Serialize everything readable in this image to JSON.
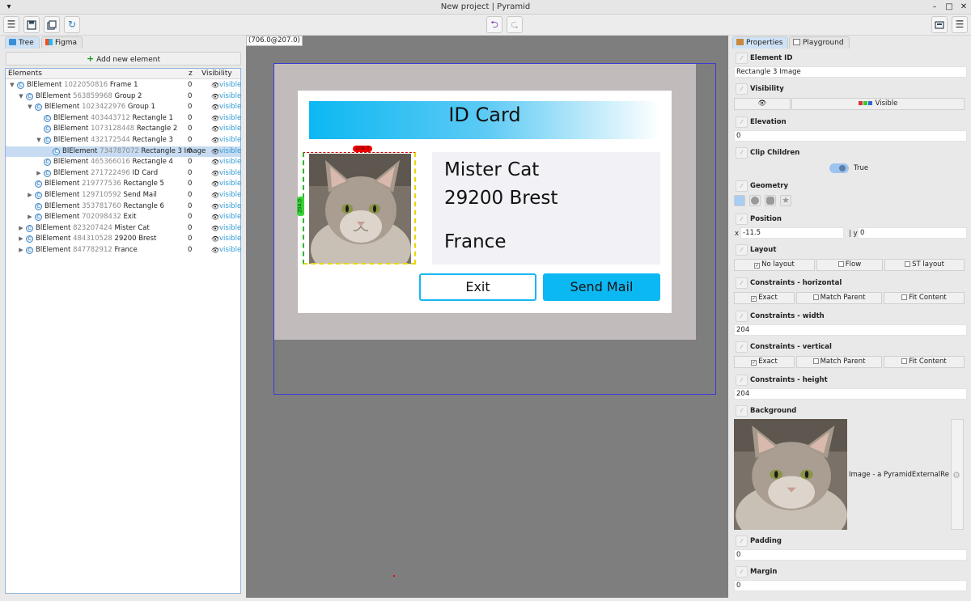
{
  "window": {
    "title": "New project | Pyramid"
  },
  "toolbar": {
    "undo_icon": "undo-arrow-icon",
    "redo_icon": "redo-arrow-icon"
  },
  "left_panel": {
    "tabs": [
      "Tree",
      "Figma"
    ],
    "add_button": "Add new element",
    "columns": {
      "elements": "Elements",
      "z": "z",
      "visibility": "Visibility"
    },
    "rows": [
      {
        "depth": 0,
        "expanded": "open",
        "type": "BlElement",
        "id": "1022050816",
        "name": "Frame 1",
        "z": "0",
        "visibility": "visible"
      },
      {
        "depth": 1,
        "expanded": "open",
        "type": "BlElement",
        "id": "563859968",
        "name": "Group 2",
        "z": "0",
        "visibility": "visible"
      },
      {
        "depth": 2,
        "expanded": "open",
        "type": "BlElement",
        "id": "1023422976",
        "name": "Group 1",
        "z": "0",
        "visibility": "visible"
      },
      {
        "depth": 3,
        "expanded": "none",
        "type": "BlElement",
        "id": "403443712",
        "name": "Rectangle 1",
        "z": "0",
        "visibility": "visible"
      },
      {
        "depth": 3,
        "expanded": "none",
        "type": "BlElement",
        "id": "1073128448",
        "name": "Rectangle 2",
        "z": "0",
        "visibility": "visible"
      },
      {
        "depth": 3,
        "expanded": "open",
        "type": "BlElement",
        "id": "432172544",
        "name": "Rectangle 3",
        "z": "0",
        "visibility": "visible"
      },
      {
        "depth": 4,
        "expanded": "none",
        "type": "BlElement",
        "id": "734787072",
        "name": "Rectangle 3 Image",
        "z": "0",
        "visibility": "visible",
        "selected": true
      },
      {
        "depth": 3,
        "expanded": "none",
        "type": "BlElement",
        "id": "465366016",
        "name": "Rectangle 4",
        "z": "0",
        "visibility": "visible"
      },
      {
        "depth": 3,
        "expanded": "closed",
        "type": "BlElement",
        "id": "271722496",
        "name": "ID Card",
        "z": "0",
        "visibility": "visible"
      },
      {
        "depth": 2,
        "expanded": "none",
        "type": "BlElement",
        "id": "219777536",
        "name": "Rectangle 5",
        "z": "0",
        "visibility": "visible"
      },
      {
        "depth": 2,
        "expanded": "closed",
        "type": "BlElement",
        "id": "129710592",
        "name": "Send Mail",
        "z": "0",
        "visibility": "visible"
      },
      {
        "depth": 2,
        "expanded": "none",
        "type": "BlElement",
        "id": "353781760",
        "name": "Rectangle 6",
        "z": "0",
        "visibility": "visible"
      },
      {
        "depth": 2,
        "expanded": "closed",
        "type": "BlElement",
        "id": "702098432",
        "name": "Exit",
        "z": "0",
        "visibility": "visible"
      },
      {
        "depth": 1,
        "expanded": "closed",
        "type": "BlElement",
        "id": "823207424",
        "name": "Mister Cat",
        "z": "0",
        "visibility": "visible"
      },
      {
        "depth": 1,
        "expanded": "closed",
        "type": "BlElement",
        "id": "484310528",
        "name": "29200 Brest",
        "z": "0",
        "visibility": "visible"
      },
      {
        "depth": 1,
        "expanded": "closed",
        "type": "BlElement",
        "id": "847782912",
        "name": "France",
        "z": "0",
        "visibility": "visible"
      }
    ]
  },
  "canvas": {
    "coordinate_readout": "(706.0@207.0)",
    "card": {
      "title": "ID Card",
      "name": "Mister Cat",
      "city": "29200 Brest",
      "country": "France",
      "exit_label": "Exit",
      "send_label": "Send Mail"
    },
    "selection": {
      "width_badge": "204.0",
      "height_badge": "204.0"
    },
    "colors": {
      "accent": "#0cb8f2",
      "frame_bg": "#c1bbbb",
      "canvas_bg": "#7e7e7e"
    }
  },
  "right_panel": {
    "tabs": [
      "Properties",
      "Playground"
    ],
    "element_id": {
      "label": "Element ID",
      "value": "Rectangle 3 Image"
    },
    "visibility": {
      "label": "Visibility",
      "value": "Visible"
    },
    "elevation": {
      "label": "Elevation",
      "value": "0"
    },
    "clip_children": {
      "label": "Clip Children",
      "value": "True"
    },
    "geometry": {
      "label": "Geometry"
    },
    "position": {
      "label": "Position",
      "x_label": "x",
      "x_value": "-11.5",
      "y_label": "| y",
      "y_value": "0"
    },
    "layout": {
      "label": "Layout",
      "options": [
        "No layout",
        "Flow",
        "ST layout"
      ]
    },
    "constraints_h": {
      "label": "Constraints - horizontal",
      "options": [
        "Exact",
        "Match Parent",
        "Fit Content"
      ]
    },
    "constraints_width": {
      "label": "Constraints - width",
      "value": "204"
    },
    "constraints_v": {
      "label": "Constraints - vertical",
      "options": [
        "Exact",
        "Match Parent",
        "Fit Content"
      ]
    },
    "constraints_height": {
      "label": "Constraints - height",
      "value": "204"
    },
    "background": {
      "label": "Background",
      "value": "Image - a PyramidExternalRessou"
    },
    "padding": {
      "label": "Padding",
      "value": "0"
    },
    "margin": {
      "label": "Margin",
      "value": "0"
    }
  }
}
